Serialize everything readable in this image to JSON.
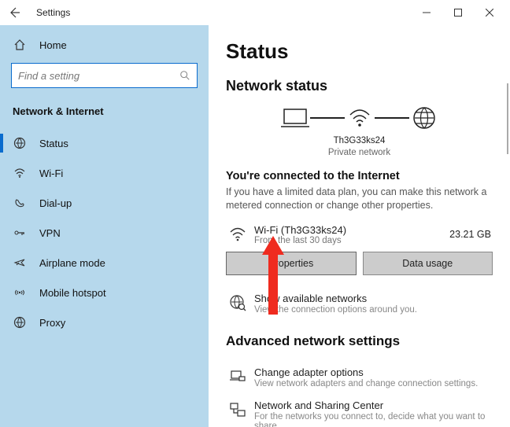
{
  "titlebar": {
    "app_title": "Settings"
  },
  "sidebar": {
    "home": "Home",
    "search_placeholder": "Find a setting",
    "section": "Network & Internet",
    "items": [
      {
        "label": "Status"
      },
      {
        "label": "Wi-Fi"
      },
      {
        "label": "Dial-up"
      },
      {
        "label": "VPN"
      },
      {
        "label": "Airplane mode"
      },
      {
        "label": "Mobile hotspot"
      },
      {
        "label": "Proxy"
      }
    ]
  },
  "main": {
    "title": "Status",
    "network_status": "Network status",
    "diagram": {
      "ssid": "Th3G33ks24",
      "type": "Private network"
    },
    "connected_title": "You're connected to the Internet",
    "connected_desc": "If you have a limited data plan, you can make this network a metered connection or change other properties.",
    "wifi": {
      "name": "Wi-Fi (Th3G33ks24)",
      "period": "From the last 30 days",
      "usage": "23.21 GB"
    },
    "buttons": {
      "properties": "Properties",
      "data_usage": "Data usage"
    },
    "show_networks": {
      "title": "Show available networks",
      "sub": "View the connection options around you."
    },
    "advanced": "Advanced network settings",
    "adapter": {
      "title": "Change adapter options",
      "sub": "View network adapters and change connection settings."
    },
    "sharing": {
      "title": "Network and Sharing Center",
      "sub": "For the networks you connect to, decide what you want to share."
    }
  }
}
